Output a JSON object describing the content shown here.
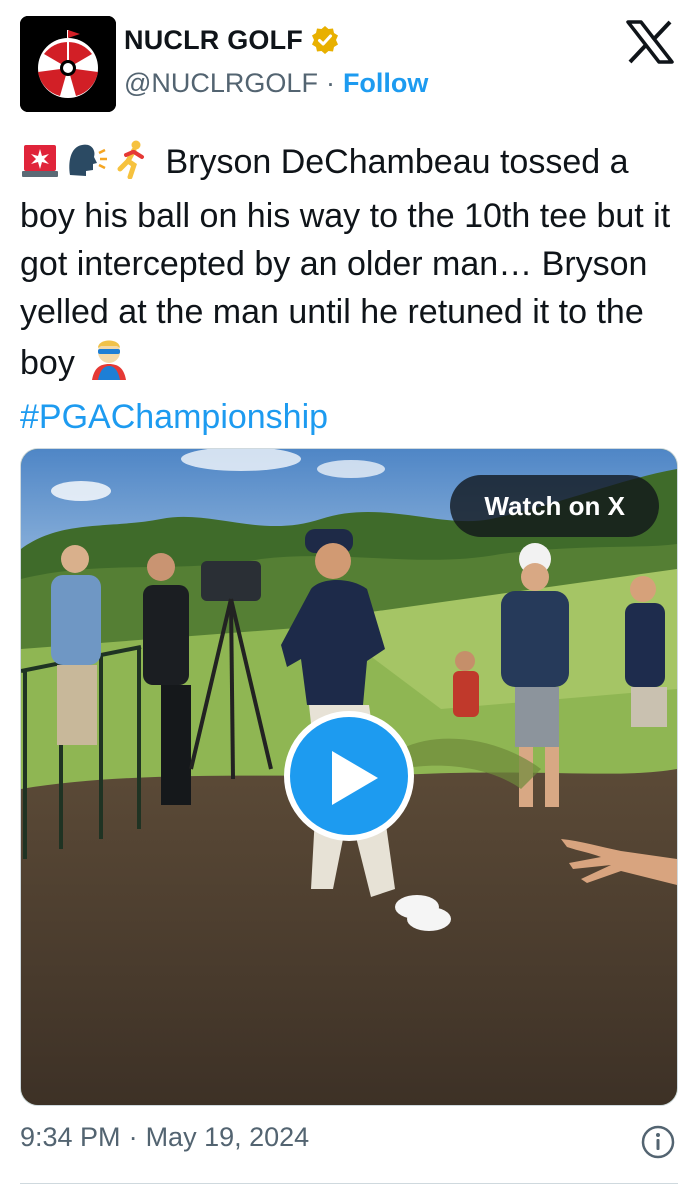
{
  "author": {
    "name": "NUCLR GOLF",
    "handle": "@NUCLRGOLF",
    "separator": "·",
    "follow_label": "Follow",
    "verified_badge_icon": "gold-verified-badge-icon",
    "avatar_icon": "nuclr-golf-logo"
  },
  "tweet": {
    "emojis": [
      "siren-emoji",
      "speaking-head-emoji",
      "running-person-emoji"
    ],
    "text_main": "Bryson DeChambeau tossed a boy his ball on his way to the 10th tee but it got intercepted by an older man… Bryson yelled at the man until he retuned it to the boy",
    "trailing_emoji": "superhero-emoji",
    "hashtag": "#PGAChampionship"
  },
  "media": {
    "watch_label": "Watch on X",
    "play_icon": "play-icon"
  },
  "footer": {
    "time": "9:34 PM",
    "separator": "·",
    "date": "May 19, 2024",
    "info_icon": "info-icon"
  },
  "colors": {
    "accent": "#1d9bf0",
    "secondary_text": "#536471",
    "primary_text": "#0f1419"
  }
}
